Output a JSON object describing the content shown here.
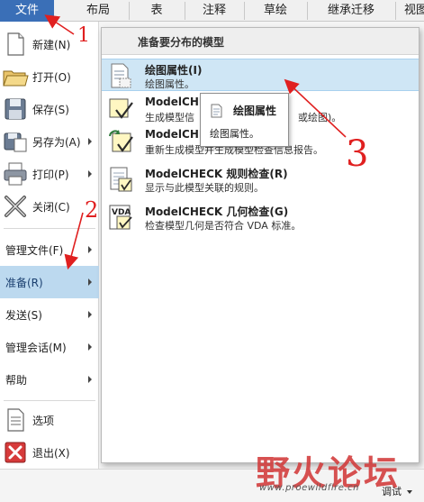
{
  "tabs": [
    {
      "label": "文件",
      "active": true
    },
    {
      "label": "布局",
      "active": false
    },
    {
      "label": "表",
      "active": false
    },
    {
      "label": "注释",
      "active": false
    },
    {
      "label": "草绘",
      "active": false
    },
    {
      "label": "继承迁移",
      "active": false
    },
    {
      "label": "视图",
      "active": false
    }
  ],
  "left_menu": {
    "new": "新建(N)",
    "open": "打开(O)",
    "save": "保存(S)",
    "save_as": "另存为(A)",
    "print": "打印(P)",
    "close": "关闭(C)",
    "manage_file": "管理文件(F)",
    "prepare": "准备(R)",
    "send": "发送(S)",
    "manage_session": "管理会话(M)",
    "help": "帮助",
    "options": "选项",
    "exit": "退出(X)"
  },
  "submenu": {
    "header": "准备要分布的模型",
    "items": [
      {
        "title": "绘图属性(I)",
        "desc": "绘图属性。"
      },
      {
        "title": "ModelCHE",
        "desc": "生成模型信",
        "desc_tail": "或绘图)。"
      },
      {
        "title": "ModelCHE",
        "desc": "重新生成模型并生成模型检查信息报告。"
      },
      {
        "title": "ModelCHECK 规则检查(R)",
        "desc": "显示与此模型关联的规则。"
      },
      {
        "title": "ModelCHECK 几何检查(G)",
        "desc": "检查模型几何是否符合 VDA 标准。"
      }
    ]
  },
  "tooltip": {
    "title": "绘图属性",
    "desc": "绘图属性。"
  },
  "icon_labels": {
    "vda": "VDA"
  },
  "status": {
    "debug": "调试"
  },
  "watermark": {
    "text": "野火论坛",
    "url": "www.proewildfire.cn"
  },
  "annotations": {
    "one": "1",
    "two": "2",
    "three": "3"
  },
  "colors": {
    "accent_tab": "#3a6fb7",
    "selected": "#bcd9ef",
    "hover": "#cfe6f5",
    "annotation": "#e02020",
    "watermark": "#d23a3a"
  }
}
